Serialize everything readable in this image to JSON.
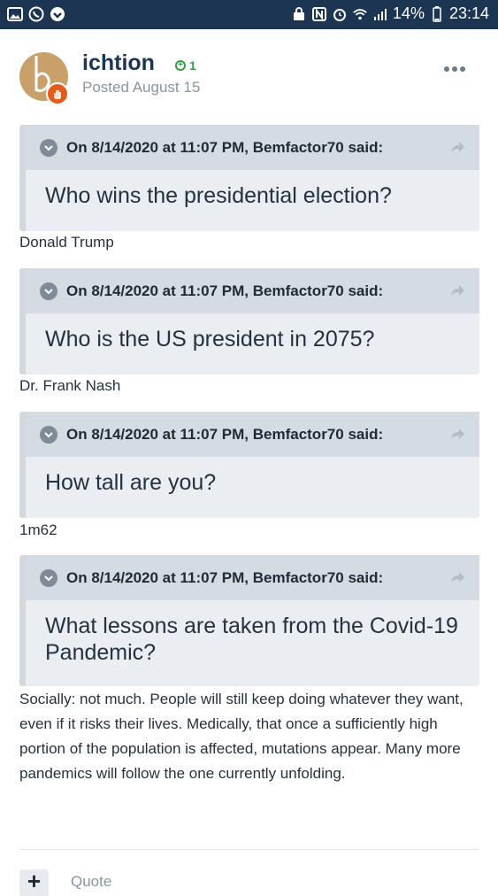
{
  "status_bar": {
    "battery_percent": "14%",
    "time": "23:14",
    "left_icons": [
      "gallery-icon",
      "whatsapp-icon",
      "download-icon"
    ],
    "right_icons": [
      "lock-icon",
      "nfc-icon",
      "alarm-icon",
      "wifi-icon",
      "signal-icon",
      "battery-icon"
    ]
  },
  "post": {
    "username": "ichtion",
    "reputation": "1",
    "posted": "Posted August 15",
    "colors": {
      "brand": "#1c3553",
      "reputation": "#3a9a4a",
      "avatar_bg": "#c9a06a",
      "badge": "#e65a1a"
    }
  },
  "items": [
    {
      "cite": "On 8/14/2020 at 11:07 PM, Bemfactor70 said:",
      "question": "Who wins the presidential election?",
      "answer": "Donald Trump"
    },
    {
      "cite": "On 8/14/2020 at 11:07 PM, Bemfactor70 said:",
      "question": "Who is the US president in 2075?",
      "answer": "Dr. Frank Nash"
    },
    {
      "cite": "On 8/14/2020 at 11:07 PM, Bemfactor70 said:",
      "question": "How tall are you?",
      "answer": "1m62"
    },
    {
      "cite": "On 8/14/2020 at 11:07 PM, Bemfactor70 said:",
      "question": "What lessons are taken from the Covid-19 Pandemic?",
      "answer": "Socially: not much. People will still keep doing whatever they want, even if it risks their lives. Medically, that once a sufficiently high portion of the population is affected, mutations appear. Many more pandemics will follow the one currently unfolding."
    }
  ],
  "actions": {
    "plus_label": "+",
    "quote_label": "Quote"
  }
}
